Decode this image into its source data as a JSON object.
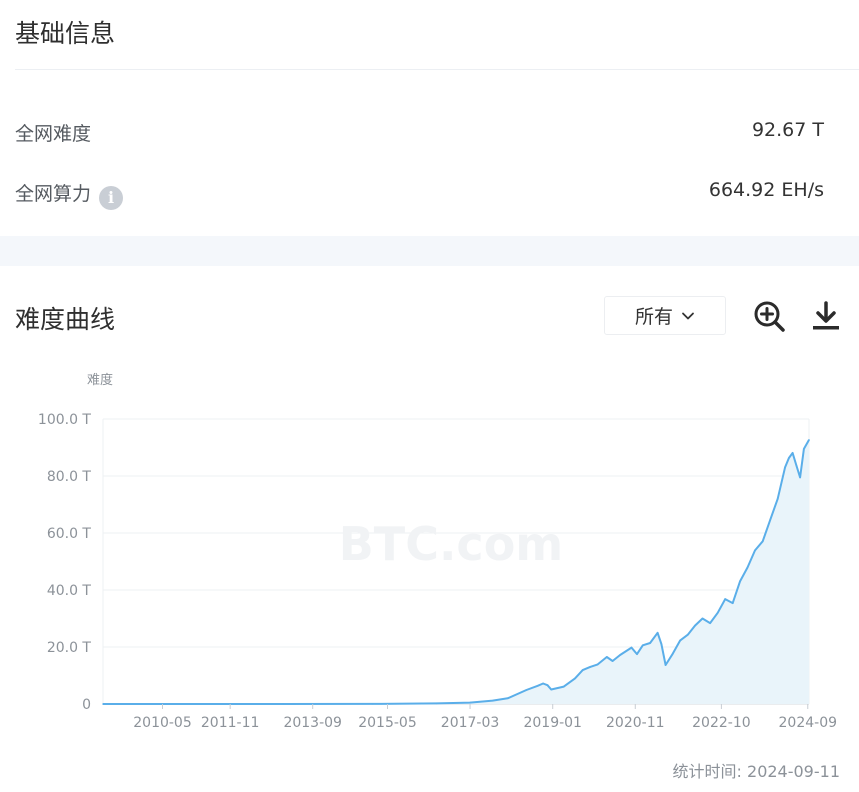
{
  "basic": {
    "title": "基础信息",
    "difficulty_label": "全网难度",
    "difficulty_value": "92.67 T",
    "hashrate_label": "全网算力",
    "hashrate_value": "664.92 EH/s",
    "info_glyph": "i"
  },
  "curve": {
    "title": "难度曲线",
    "range_selected": "所有"
  },
  "footer": {
    "stat_time": "统计时间: 2024-09-11"
  },
  "colors": {
    "line": "#5aaee9",
    "area": "#e9f4fa",
    "grid": "#eef0f3",
    "axis_text": "#8c9299"
  },
  "icons": [
    "info-icon",
    "chevron-down-icon",
    "zoom-in-icon",
    "download-icon"
  ],
  "chart_data": {
    "type": "area",
    "ylabel": "难度",
    "watermark": "BTC.com",
    "ylim": [
      0,
      100
    ],
    "yticks": [
      0,
      20,
      40,
      60,
      80,
      100
    ],
    "ytick_labels": [
      "0",
      "20.0 T",
      "40.0 T",
      "60.0 T",
      "80.0 T",
      "100.0 T"
    ],
    "xlim": [
      "2009-01-03",
      "2024-09-11"
    ],
    "xticks": [
      "2010-05",
      "2011-11",
      "2013-09",
      "2015-05",
      "2017-03",
      "2019-01",
      "2020-11",
      "2022-10",
      "2024-09"
    ],
    "grid": true,
    "x": [
      "2009-01-03",
      "2013-01-01",
      "2015-01-01",
      "2016-06-01",
      "2017-03-01",
      "2017-09-01",
      "2018-01-01",
      "2018-06-01",
      "2018-09-01",
      "2018-10-15",
      "2018-11-20",
      "2018-12-20",
      "2019-04-01",
      "2019-07-01",
      "2019-09-01",
      "2019-11-01",
      "2020-01-01",
      "2020-03-15",
      "2020-05-01",
      "2020-07-01",
      "2020-10-01",
      "2020-11-15",
      "2021-01-01",
      "2021-03-01",
      "2021-05-01",
      "2021-06-01",
      "2021-07-05",
      "2021-09-01",
      "2021-11-01",
      "2022-01-01",
      "2022-03-01",
      "2022-05-01",
      "2022-07-01",
      "2022-09-01",
      "2022-11-01",
      "2023-01-01",
      "2023-03-01",
      "2023-05-01",
      "2023-07-01",
      "2023-09-01",
      "2023-11-01",
      "2024-01-01",
      "2024-03-01",
      "2024-04-01",
      "2024-05-01",
      "2024-06-01",
      "2024-07-01",
      "2024-08-01",
      "2024-09-11"
    ],
    "series": [
      {
        "values": [
          0,
          0.01,
          0.04,
          0.2,
          0.5,
          1.2,
          2.0,
          4.9,
          6.4,
          7.2,
          6.6,
          5.1,
          6.1,
          9.0,
          11.9,
          13.0,
          13.9,
          16.5,
          15.1,
          17.2,
          19.8,
          17.5,
          20.6,
          21.4,
          25.0,
          21.0,
          13.7,
          17.6,
          22.3,
          24.3,
          27.5,
          30.0,
          28.4,
          32.0,
          36.8,
          35.4,
          43.0,
          47.9,
          53.9,
          57.1,
          64.6,
          72.0,
          83.1,
          86.3,
          88.1,
          83.7,
          79.5,
          89.5,
          92.67
        ]
      }
    ]
  }
}
